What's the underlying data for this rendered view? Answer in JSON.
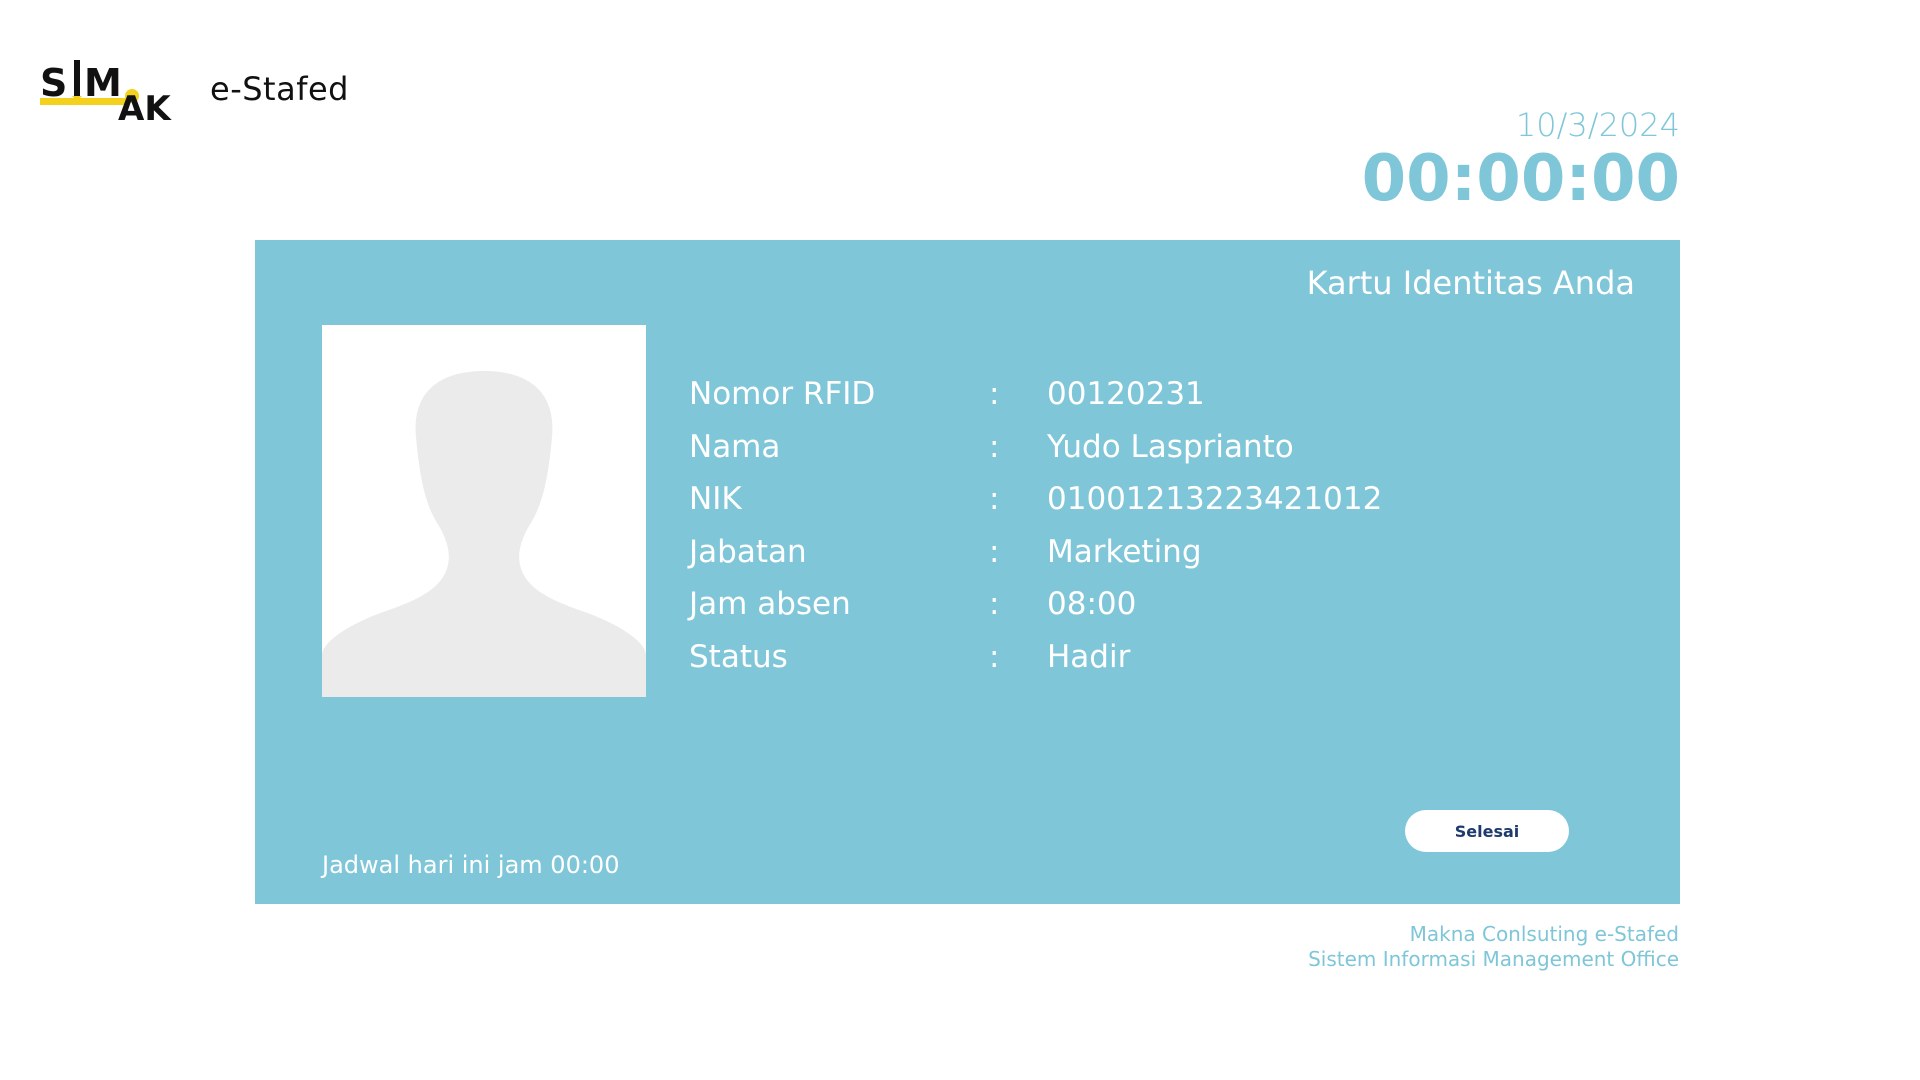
{
  "brand": {
    "logo_text": "SIMAK",
    "app_name": "e-Stafed"
  },
  "datetime": {
    "date": "10/3/2024",
    "time": "00:00:00"
  },
  "card": {
    "title": "Kartu Identitas Anda",
    "photo_icon": "person-silhouette-icon",
    "fields": [
      {
        "label": "Nomor RFID",
        "separator": ":",
        "value": "00120231"
      },
      {
        "label": "Nama",
        "separator": ":",
        "value": "Yudo Lasprianto"
      },
      {
        "label": "NIK",
        "separator": ":",
        "value": "01001213223421012"
      },
      {
        "label": "Jabatan",
        "separator": ":",
        "value": "Marketing"
      },
      {
        "label": "Jam absen",
        "separator": ":",
        "value": "08:00"
      },
      {
        "label": "Status",
        "separator": ":",
        "value": "Hadir"
      }
    ],
    "done_button": "Selesai",
    "schedule_text": "Jadwal hari ini jam 00:00"
  },
  "footer": {
    "line1": "Makna Conlsuting e-Stafed",
    "line2": "Sistem Informasi Management Office"
  },
  "colors": {
    "accent": "#80c6d9",
    "text_accent": "#7ec6d8",
    "logo_yellow": "#f4d11c",
    "button_text": "#1f3b6e"
  }
}
